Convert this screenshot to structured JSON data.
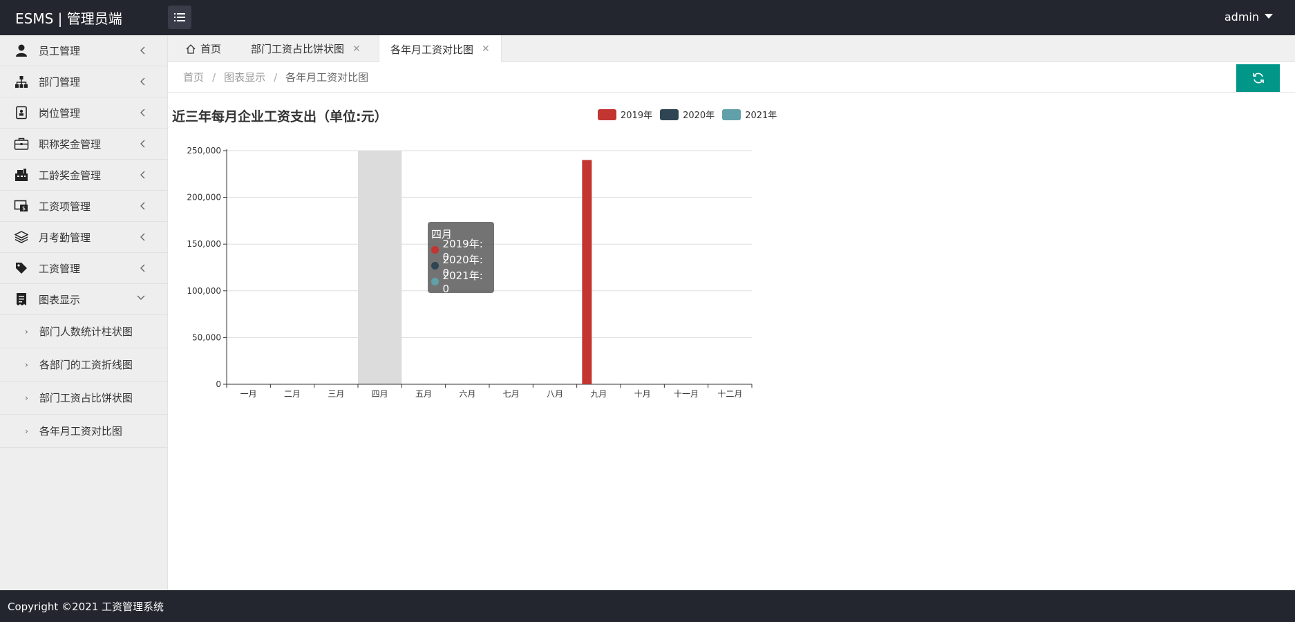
{
  "app": {
    "title": "ESMS | 管理员端",
    "user": "admin"
  },
  "sidebar": {
    "items": [
      {
        "label": "员工管理",
        "icon": "user-icon"
      },
      {
        "label": "部门管理",
        "icon": "sitemap-icon"
      },
      {
        "label": "岗位管理",
        "icon": "id-card-icon"
      },
      {
        "label": "职称奖金管理",
        "icon": "briefcase-icon"
      },
      {
        "label": "工龄奖金管理",
        "icon": "register-icon"
      },
      {
        "label": "工资项管理",
        "icon": "money-screen-icon"
      },
      {
        "label": "月考勤管理",
        "icon": "layers-icon"
      },
      {
        "label": "工资管理",
        "icon": "tag-icon"
      },
      {
        "label": "图表显示",
        "icon": "receipt-icon"
      }
    ],
    "subitems": [
      {
        "label": "部门人数统计柱状图"
      },
      {
        "label": "各部门的工资折线图"
      },
      {
        "label": "部门工资占比饼状图"
      },
      {
        "label": "各年月工资对比图"
      }
    ]
  },
  "tabs": [
    {
      "label": "首页"
    },
    {
      "label": "部门工资占比饼状图"
    },
    {
      "label": "各年月工资对比图"
    }
  ],
  "breadcrumb": {
    "home": "首页",
    "section": "图表显示",
    "current": "各年月工资对比图"
  },
  "footer": {
    "text": "Copyright ©2021 工资管理系统"
  },
  "chart_data": {
    "type": "bar",
    "title": "近三年每月企业工资支出（单位:元）",
    "categories": [
      "一月",
      "二月",
      "三月",
      "四月",
      "五月",
      "六月",
      "七月",
      "八月",
      "九月",
      "十月",
      "十一月",
      "十二月"
    ],
    "series": [
      {
        "name": "2019年",
        "color": "#c23531",
        "values": [
          0,
          0,
          0,
          0,
          0,
          0,
          0,
          0,
          240000,
          0,
          0,
          0
        ]
      },
      {
        "name": "2020年",
        "color": "#2f4554",
        "values": [
          0,
          0,
          0,
          0,
          0,
          0,
          0,
          0,
          0,
          0,
          0,
          0
        ]
      },
      {
        "name": "2021年",
        "color": "#61a0a8",
        "values": [
          0,
          0,
          0,
          0,
          0,
          0,
          0,
          0,
          0,
          0,
          0,
          0
        ]
      }
    ],
    "ylim": [
      0,
      250000
    ],
    "yticks": [
      "0",
      "50,000",
      "100,000",
      "150,000",
      "200,000",
      "250,000"
    ],
    "grid": true,
    "legend_position": "top-right",
    "highlighted_category_index": 3,
    "tooltip": {
      "title": "四月",
      "rows": [
        "2019年: 0",
        "2020年: 0",
        "2021年: 0"
      ]
    }
  }
}
